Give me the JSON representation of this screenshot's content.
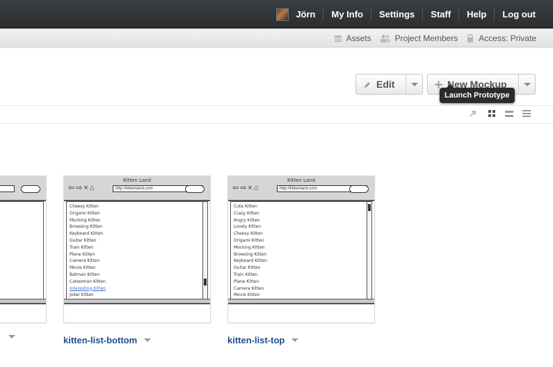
{
  "topnav": {
    "user": "Jörn",
    "items": [
      "My Info",
      "Settings",
      "Staff",
      "Help",
      "Log out"
    ]
  },
  "subbar": {
    "items": [
      {
        "label": "Assets",
        "icon": "assets-icon"
      },
      {
        "label": "Project Members",
        "icon": "members-icon"
      },
      {
        "label": "Access: Private",
        "icon": "lock-icon"
      }
    ]
  },
  "toolbar": {
    "edit_label": "Edit",
    "new_mockup_label": "New Mockup",
    "tooltip": "Launch Prototype"
  },
  "cards": [
    {
      "label": "",
      "title": "",
      "url": "",
      "items": []
    },
    {
      "label": "kitten-list-bottom",
      "title": "Kitten Land",
      "url": "http://kittenland.com",
      "items": [
        "Cheesy Kitten",
        "Origami Kitten",
        "Mocking Kitten",
        "Browsing Kitten",
        "Keyboard Kitten",
        "Guitar Kitten",
        "Train Kitten",
        "Plane Kitten",
        "Camera Kitten",
        "Movie Kitten",
        "Batman Kitten",
        "Catwoman Kitten",
        "Interesting Kitten",
        "Joker Kitten"
      ],
      "link_index": 12,
      "scroll_position": "bottom"
    },
    {
      "label": "kitten-list-top",
      "title": "Kitten Land",
      "url": "http://kittenland.com",
      "items": [
        "Cute Kitten",
        "Crazy Kitten",
        "Angry Kitten",
        "Lovely Kitten",
        "Cheesy Kitten",
        "Origami Kitten",
        "Mocking Kitten",
        "Browsing Kitten",
        "Keyboard Kitten",
        "Guitar Kitten",
        "Train Kitten",
        "Plane Kitten",
        "Camera Kitten",
        "Movie Kitten"
      ],
      "link_index": -1,
      "scroll_position": "top"
    }
  ],
  "colors": {
    "topnav_bg": "#2f3133",
    "label_blue": "#214e8a",
    "link_blue": "#3b6ad6"
  }
}
